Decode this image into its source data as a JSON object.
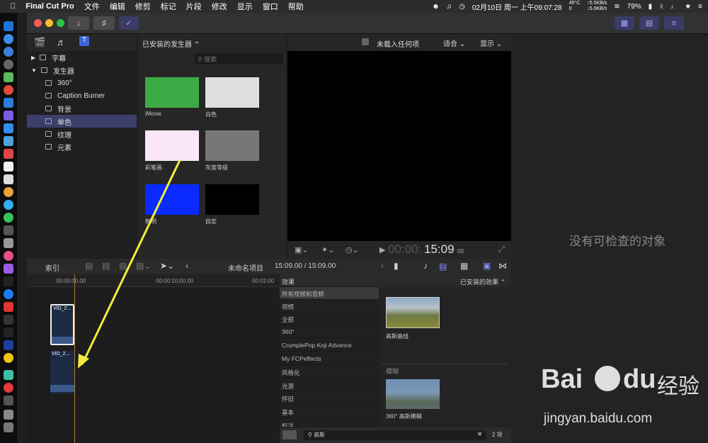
{
  "menubar": {
    "apple": "",
    "app": "Final Cut Pro",
    "items": [
      "文件",
      "编辑",
      "修剪",
      "标记",
      "片段",
      "修改",
      "显示",
      "窗口",
      "帮助"
    ],
    "status": {
      "datetime": "02月10日 周一 上午09:07:28",
      "temp": "45°C",
      "net_up": "↑5.5KB/s",
      "net_down": "↓5.0KB/s",
      "net_zero": "0",
      "battery": "79%"
    }
  },
  "library": {
    "tree": [
      {
        "label": "字幕",
        "type": "group",
        "expanded": false
      },
      {
        "label": "发生器",
        "type": "group",
        "expanded": true
      },
      {
        "label": "360°"
      },
      {
        "label": "Caption Burner"
      },
      {
        "label": "背景"
      },
      {
        "label": "单色",
        "selected": true
      },
      {
        "label": "纹理"
      },
      {
        "label": "元素"
      }
    ]
  },
  "browser": {
    "title": "已安装的发生器 ⌃",
    "search_placeholder": "搜索",
    "items": [
      {
        "label": "iMovie",
        "color": "#3cab45"
      },
      {
        "label": "白色",
        "color": "#dedede"
      },
      {
        "label": "彩笔画",
        "color": "#fbe6f8"
      },
      {
        "label": "灰度等级",
        "color": "#777777"
      },
      {
        "label": "鲜明",
        "color": "#0a2aff"
      },
      {
        "label": "自定",
        "color": "#000000"
      }
    ]
  },
  "viewer": {
    "status": "未载入任何项",
    "fit": "适合",
    "display": "显示",
    "timecode_dim": "00:00:",
    "timecode": "15:09",
    "timecode_frames": "00"
  },
  "inspector": {
    "empty": "没有可检查的对象"
  },
  "timeline_bar": {
    "index": "索引",
    "project": "未命名项目",
    "duration": "15:09.00 / 15:09.00"
  },
  "ruler": {
    "ticks": [
      "00:00:00.00",
      "00:00:10:00.00",
      "00:02:00"
    ]
  },
  "clips": [
    {
      "label": "VID_2..."
    },
    {
      "label": "VID_2..."
    }
  ],
  "effects": {
    "header": "效果",
    "installed": "已安装的效果 ⌃",
    "categories": [
      "所有视频和音频",
      "视频",
      "全部",
      "360°",
      "CrumplePop Koji Advance",
      "My FCPeffects",
      "风格化",
      "光源",
      "怀旧",
      "基本",
      "标注"
    ],
    "items": [
      {
        "label": "高斯曲线"
      },
      {
        "section": "模糊"
      },
      {
        "label": "360° 高斯模糊"
      }
    ],
    "search": "高斯",
    "count": "2 项"
  },
  "watermark": {
    "brand": "Bai",
    "brand2": "du",
    "cn": "经验",
    "url": "jingyan.baidu.com"
  }
}
